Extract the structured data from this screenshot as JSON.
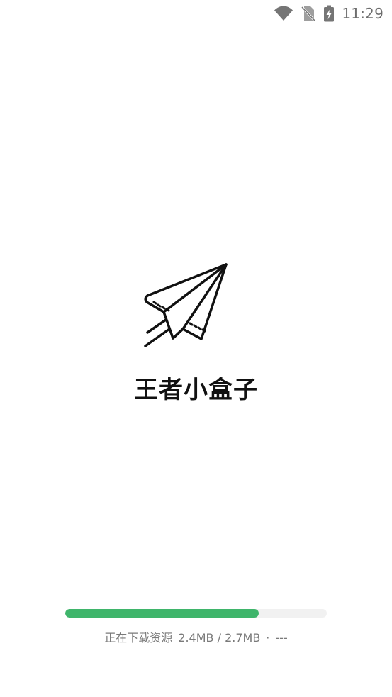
{
  "status_bar": {
    "time": "11:29",
    "icons": [
      "wifi-icon",
      "no-sim-icon",
      "battery-charging-icon"
    ],
    "icon_color": "#757575"
  },
  "app": {
    "title": "王者小盒子",
    "logo_icon": "paper-plane-icon"
  },
  "download": {
    "status_label": "正在下载资源",
    "size_progress": "2.4MB / 2.7MB",
    "separator": "·",
    "speed": "---",
    "progress_fraction": 0.74,
    "bar_color": "#3fb56b",
    "track_color": "#f1f1f1"
  }
}
